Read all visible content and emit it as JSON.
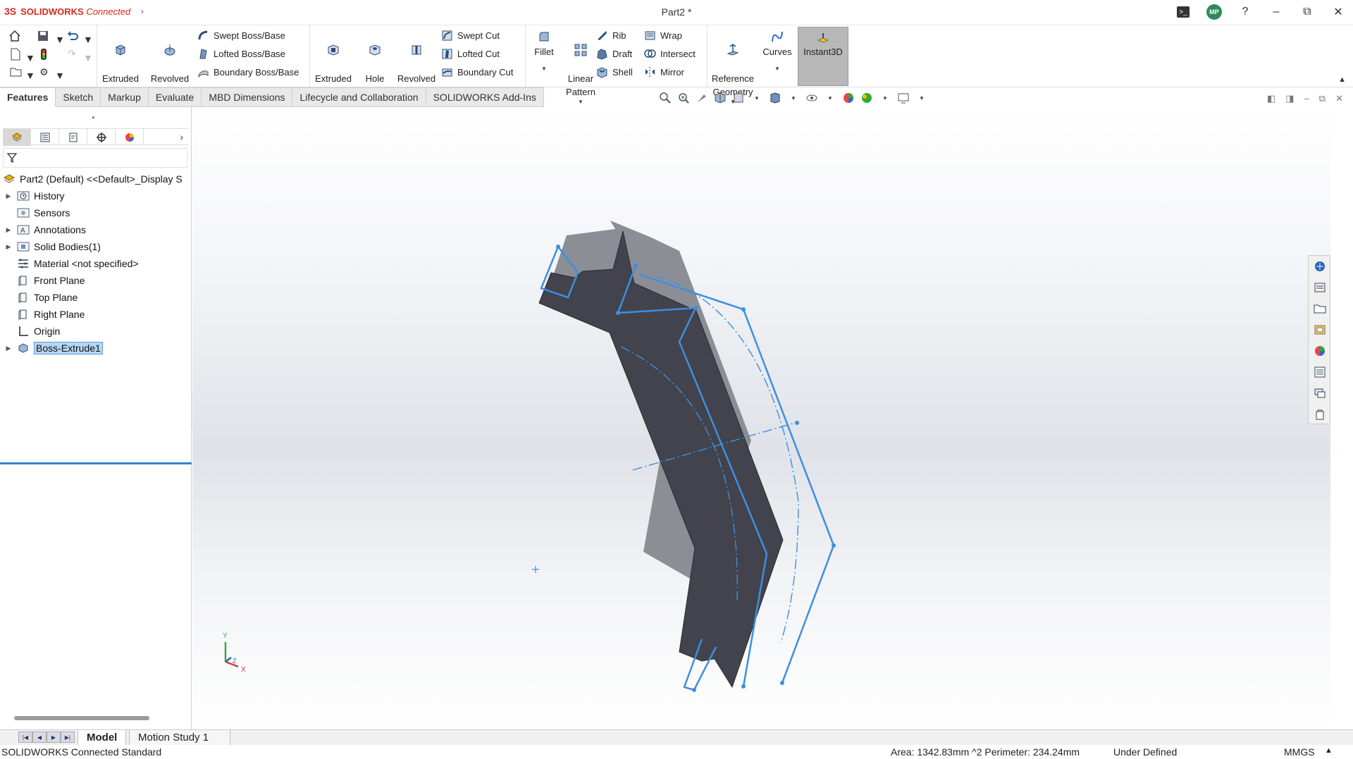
{
  "app": {
    "brand_logo": "3S",
    "brand_name_bold": "SOLIDWORKS",
    "brand_name_rest": " Connected",
    "document_title": "Part2 *",
    "user_initials": "MP"
  },
  "ribbon": {
    "extruded_boss": "Extruded\nBoss/Base",
    "revolved_boss": "Revolved\nBoss/Base",
    "swept_boss": "Swept Boss/Base",
    "lofted_boss": "Lofted Boss/Base",
    "boundary_boss": "Boundary Boss/Base",
    "extruded_cut": "Extruded\nCut",
    "hole_wizard": "Hole\nWizard",
    "revolved_cut": "Revolved\nCut",
    "swept_cut": "Swept Cut",
    "lofted_cut": "Lofted Cut",
    "boundary_cut": "Boundary Cut",
    "fillet": "Fillet",
    "linear_pattern": "Linear\nPattern",
    "rib": "Rib",
    "draft": "Draft",
    "shell": "Shell",
    "wrap": "Wrap",
    "intersect": "Intersect",
    "mirror": "Mirror",
    "reference_geometry": "Reference\nGeometry",
    "curves": "Curves",
    "instant3d": "Instant3D"
  },
  "tabs": [
    {
      "label": "Features"
    },
    {
      "label": "Sketch"
    },
    {
      "label": "Markup"
    },
    {
      "label": "Evaluate"
    },
    {
      "label": "MBD Dimensions"
    },
    {
      "label": "Lifecycle and Collaboration"
    },
    {
      "label": "SOLIDWORKS Add-Ins"
    }
  ],
  "tree": {
    "root": "Part2 (Default) <<Default>_Display S",
    "items": [
      {
        "label": "History"
      },
      {
        "label": "Sensors"
      },
      {
        "label": "Annotations"
      },
      {
        "label": "Solid Bodies(1)"
      },
      {
        "label": "Material <not specified>"
      },
      {
        "label": "Front Plane"
      },
      {
        "label": "Top Plane"
      },
      {
        "label": "Right Plane"
      },
      {
        "label": "Origin"
      },
      {
        "label": "Boss-Extrude1"
      }
    ]
  },
  "triad": {
    "y": "Y",
    "x": "X",
    "z": "Z"
  },
  "bottom_tabs": [
    {
      "label": "Model"
    },
    {
      "label": "Motion Study 1"
    }
  ],
  "status": {
    "product": "SOLIDWORKS Connected Standard",
    "measure": "Area: 1342.83mm ^2 Perimeter: 234.24mm",
    "state": "Under Defined",
    "units": "MMGS"
  },
  "colors": {
    "brand_red": "#d52b1e",
    "selection_blue": "#3d8fe0",
    "part_face": "#42434c",
    "part_side": "#8c8e96"
  }
}
